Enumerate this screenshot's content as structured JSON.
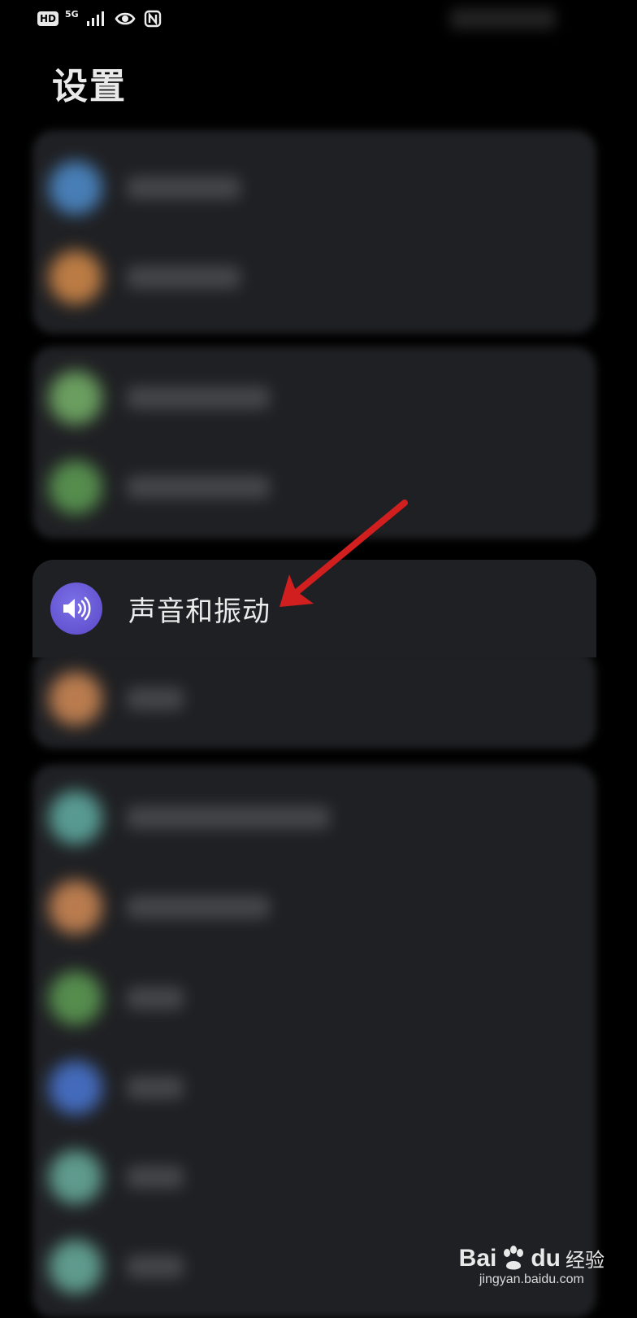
{
  "page": {
    "title": "设置"
  },
  "status_bar": {
    "hd_label": "HD",
    "network_label": "5G"
  },
  "focused_item": {
    "label": "声音和振动",
    "icon": "speaker-icon",
    "icon_color": "#5f4fd0"
  },
  "blurred_items": [
    {
      "icon_color": "#4f8fd0"
    },
    {
      "icon_color": "#d78c4a"
    },
    {
      "icon_color": "#78b46a"
    },
    {
      "icon_color": "#5fa055"
    },
    {
      "icon_color": "#d48c56"
    },
    {
      "icon_color": "#62b0a6"
    },
    {
      "icon_color": "#d48c56"
    },
    {
      "icon_color": "#5fa055"
    },
    {
      "icon_color": "#4a78d6"
    },
    {
      "icon_color": "#6ab0a0"
    },
    {
      "icon_color": "#6ab0a0"
    }
  ],
  "annotation": {
    "arrow_color": "#d11f1f"
  },
  "watermark": {
    "brand_left": "Bai",
    "brand_right": "du",
    "product": "经验",
    "url": "jingyan.baidu.com"
  }
}
